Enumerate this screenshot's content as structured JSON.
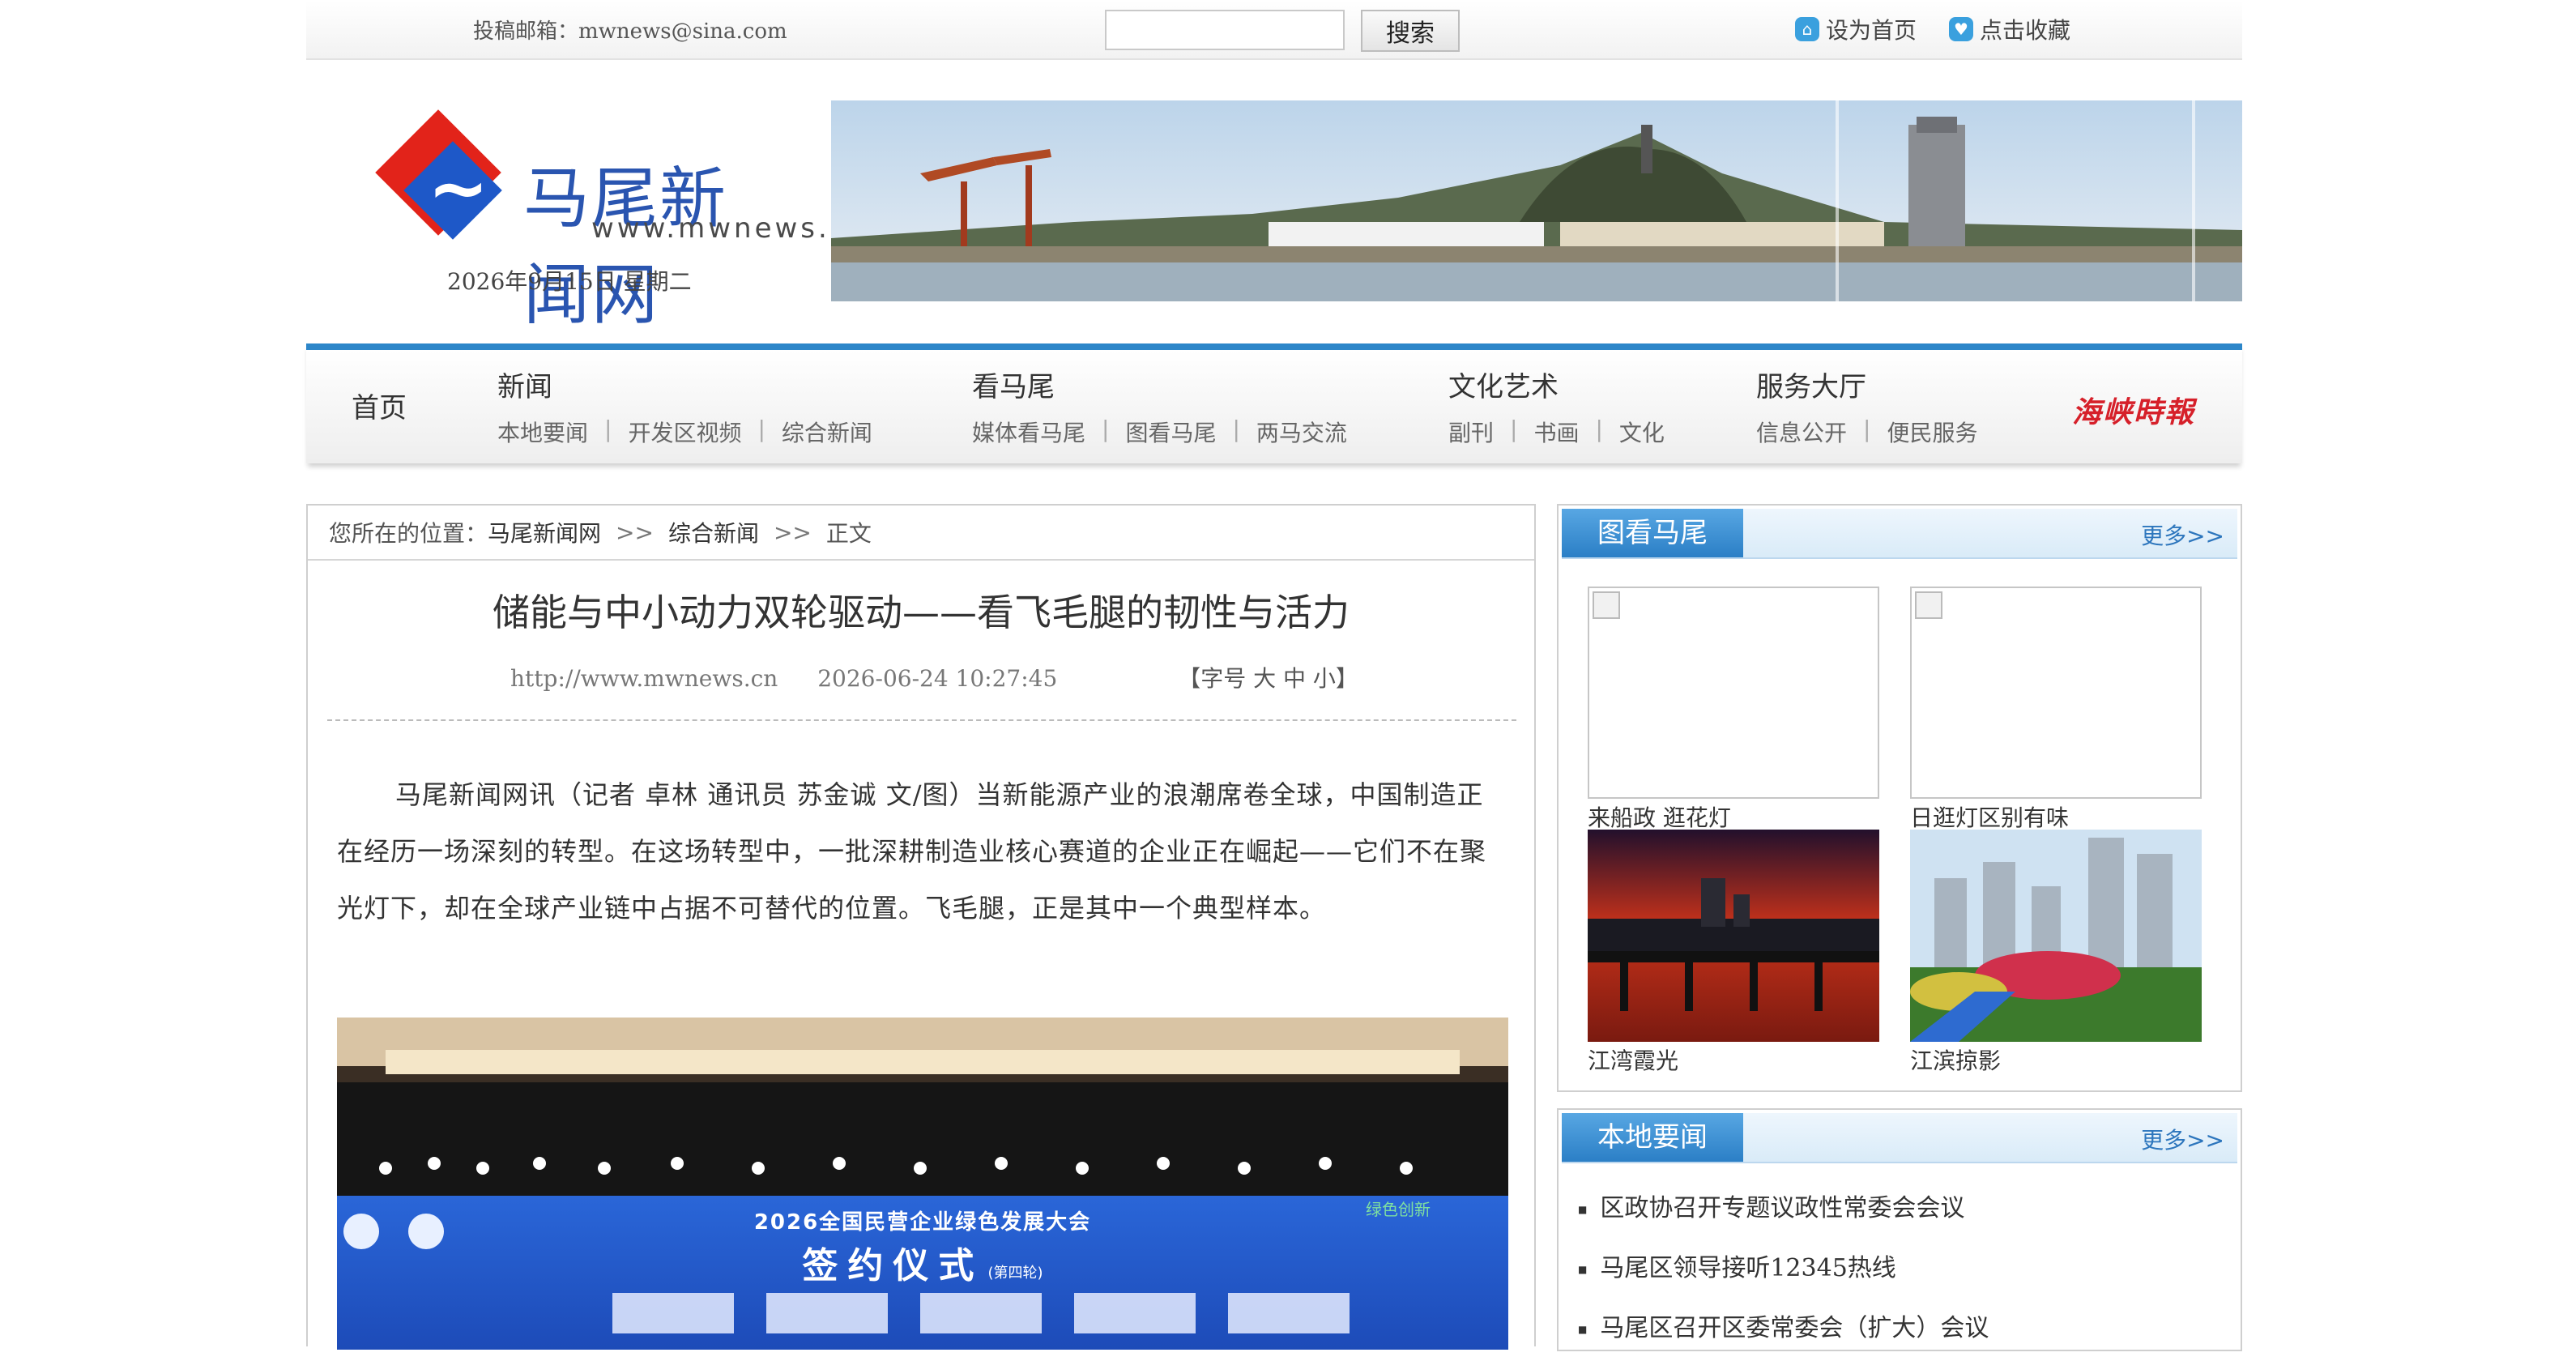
{
  "topbar": {
    "email": "投稿邮箱：mwnews@sina.com",
    "search_placeholder": "",
    "search_button": "搜索",
    "set_home": "设为首页",
    "bookmark": "点击收藏"
  },
  "header": {
    "site_name": "马尾新闻网",
    "site_url": "www.mwnews.cn",
    "date": "2026年9月15日  星期二"
  },
  "nav": {
    "home": "首页",
    "groups": [
      {
        "title": "新闻",
        "subs": [
          "本地要闻",
          "开发区视频",
          "综合新闻"
        ]
      },
      {
        "title": "看马尾",
        "subs": [
          "媒体看马尾",
          "图看马尾",
          "两马交流"
        ]
      },
      {
        "title": "文化艺术",
        "subs": [
          "副刊",
          "书画",
          "文化"
        ]
      },
      {
        "title": "服务大厅",
        "subs": [
          "信息公开",
          "便民服务"
        ]
      }
    ],
    "partner": "海峡時報"
  },
  "breadcrumb": {
    "prefix": "您所在的位置：",
    "items": [
      "马尾新闻网",
      "综合新闻",
      "正文"
    ],
    "separator": ">>"
  },
  "article": {
    "title": "储能与中小动力双轮驱动——看飞毛腿的韧性与活力",
    "source": "http://www.mwnews.cn",
    "time": "2026-06-24 10:27:45",
    "font_size_label": "【字号 大 中 小】",
    "paragraph": "马尾新闻网讯（记者 卓林 通讯员 苏金诚 文/图）当新能源产业的浪潮席卷全球，中国制造正在经历一场深刻的转型。在这场转型中，一批深耕制造业核心赛道的企业正在崛起——它们不在聚光灯下，却在全球产业链中占据不可替代的位置。飞毛腿，正是其中一个典型样本。",
    "photo_banner_title": "2026全国民营企业绿色发展大会",
    "photo_banner_sub": "签约仪式",
    "photo_banner_round": "(第四轮)"
  },
  "photo_box": {
    "title": "图看马尾",
    "more": "更多>>",
    "items": [
      {
        "caption": "来船政 逛花灯"
      },
      {
        "caption": "日逛灯区别有味"
      },
      {
        "caption": "江湾霞光"
      },
      {
        "caption": "江滨掠影"
      }
    ]
  },
  "news_box": {
    "title": "本地要闻",
    "more": "更多>>",
    "items": [
      "区政协召开专题议政性常委会会议",
      "马尾区领导接听12345热线",
      "马尾区召开区委常委会（扩大）会议"
    ]
  },
  "colors": {
    "nav_accent": "#2d86c9",
    "tab_blue": "#2b7fc6",
    "logo_red": "#e2231a",
    "logo_blue": "#1e58c8"
  }
}
